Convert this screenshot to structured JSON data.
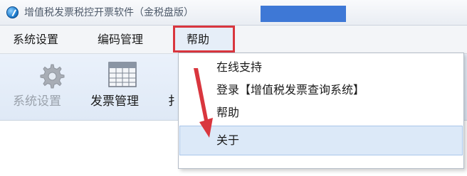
{
  "window": {
    "title": "增值税发票税控开票软件（金税盘版）",
    "redaction_color": "#3e78d6"
  },
  "menubar": {
    "items": [
      {
        "id": "system_settings",
        "label": "系统设置"
      },
      {
        "id": "code_management",
        "label": "编码管理"
      },
      {
        "id": "help",
        "label": "帮助",
        "highlighted": true
      }
    ]
  },
  "toolbar": {
    "buttons": [
      {
        "id": "system_settings",
        "label": "系统设置",
        "icon": "gear-icon",
        "disabled": true
      },
      {
        "id": "invoice_management",
        "label": "发票管理",
        "icon": "invoice-grid-icon",
        "disabled": false
      }
    ],
    "truncated_label": "扌"
  },
  "help_menu": {
    "items": [
      {
        "id": "online_support",
        "label": "在线支持"
      },
      {
        "id": "login_query",
        "label": "登录【增值税发票查询系统】"
      },
      {
        "id": "help",
        "label": "帮助"
      },
      {
        "id": "about",
        "label": "关于",
        "selected": true
      }
    ]
  },
  "annotation": {
    "color": "#d9363e",
    "box_target": "help",
    "arrow_target": "about"
  }
}
